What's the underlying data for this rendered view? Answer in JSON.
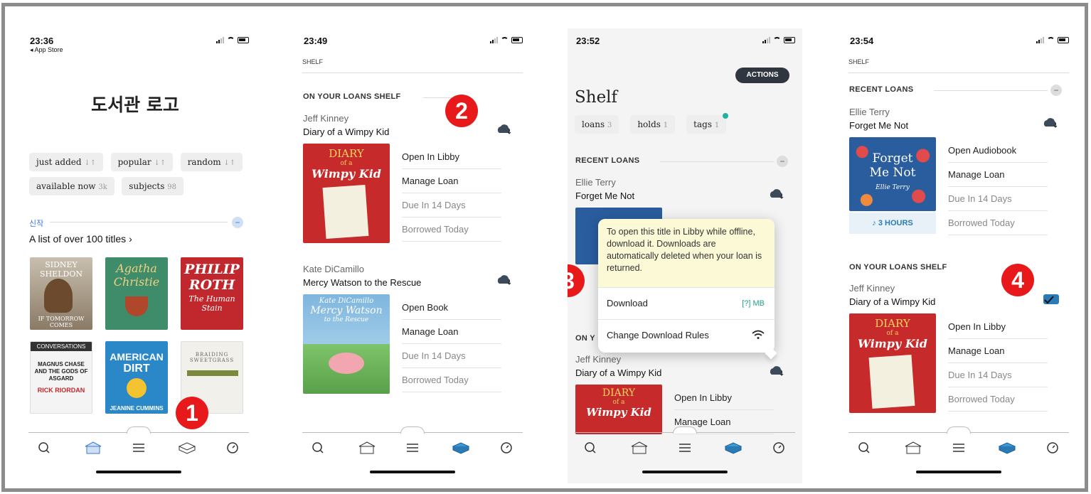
{
  "p1": {
    "time": "23:36",
    "back": "◂ App Store",
    "logo": "도서관 로고",
    "filters": [
      "just added",
      "popular",
      "random"
    ],
    "filters2": [
      {
        "label": "available now",
        "count": "3k"
      },
      {
        "label": "subjects",
        "count": "98"
      }
    ],
    "section": "신작",
    "list_title": "A list of over 100 titles",
    "covers": [
      {
        "line1": "SIDNEY",
        "line2": "SHELDON",
        "line3": "IF TOMORROW COMES"
      },
      {
        "line1": "Agatha",
        "line2": "Christie",
        "line3": ""
      },
      {
        "line1": "PHILIP",
        "line2": "ROTH",
        "line3": "The Human Stain"
      },
      {
        "line1": "CONVERSATIONS",
        "line2": "MAGNUS CHASE AND THE GODS OF ASGARD",
        "line3": "RICK RIORDAN"
      },
      {
        "line1": "AMERICAN",
        "line2": "DIRT",
        "line3": "JEANINE CUMMINS"
      },
      {
        "line1": "BRAIDING",
        "line2": "SWEETGRASS",
        "line3": ""
      }
    ],
    "badge": "1"
  },
  "p2": {
    "time": "23:49",
    "shelf": "SHELF",
    "section": "ON YOUR LOANS SHELF",
    "badge": "2",
    "book1": {
      "author": "Jeff Kinney",
      "title": "Diary of a Wimpy Kid",
      "actions": [
        "Open In Libby",
        "Manage Loan",
        "Due In 14 Days",
        "Borrowed Today"
      ],
      "cover1": "DIARY",
      "cover2": "of a",
      "cover3": "Wimpy Kid"
    },
    "book2": {
      "author": "Kate DiCamillo",
      "title": "Mercy Watson to the Rescue",
      "actions": [
        "Open Book",
        "Manage Loan",
        "Due In 14 Days",
        "Borrowed Today"
      ],
      "cover1": "Kate DiCamillo",
      "cover2": "Mercy Watson",
      "cover3": "to the Rescue"
    }
  },
  "p3": {
    "time": "23:52",
    "actions_btn": "ACTIONS",
    "heading": "Shelf",
    "tabs": [
      {
        "label": "loans",
        "count": "3"
      },
      {
        "label": "holds",
        "count": "1"
      },
      {
        "label": "tags",
        "count": "1"
      }
    ],
    "section": "RECENT LOANS",
    "book1": {
      "author": "Ellie Terry",
      "title": "Forget Me Not"
    },
    "popup": {
      "text": "To open this title in Libby while offline, download it. Downloads are automatically deleted when your loan is returned.",
      "download": "Download",
      "size": "[?] MB",
      "rules": "Change Download Rules"
    },
    "section2": "ON Y",
    "book2": {
      "author": "Jeff Kinney",
      "title": "Diary of a Wimpy Kid",
      "actions": [
        "Open In Libby",
        "Manage Loan"
      ],
      "cover1": "DIARY",
      "cover2": "of a",
      "cover3": "Wimpy Kid"
    },
    "badge": "3"
  },
  "p4": {
    "time": "23:54",
    "shelf": "SHELF",
    "section": "RECENT LOANS",
    "book1": {
      "author": "Ellie Terry",
      "title": "Forget Me Not",
      "actions": [
        "Open Audiobook",
        "Manage Loan",
        "Due In 14 Days",
        "Borrowed Today"
      ],
      "hours": "3 HOURS",
      "cover1": "Forget",
      "cover2": "Me Not",
      "cover3": "Ellie Terry"
    },
    "section2": "ON YOUR LOANS SHELF",
    "book2": {
      "author": "Jeff Kinney",
      "title": "Diary of a Wimpy Kid",
      "actions": [
        "Open In Libby",
        "Manage Loan",
        "Due In 14 Days",
        "Borrowed Today"
      ],
      "cover1": "DIARY",
      "cover2": "of a",
      "cover3": "Wimpy Kid"
    },
    "badge": "4"
  }
}
